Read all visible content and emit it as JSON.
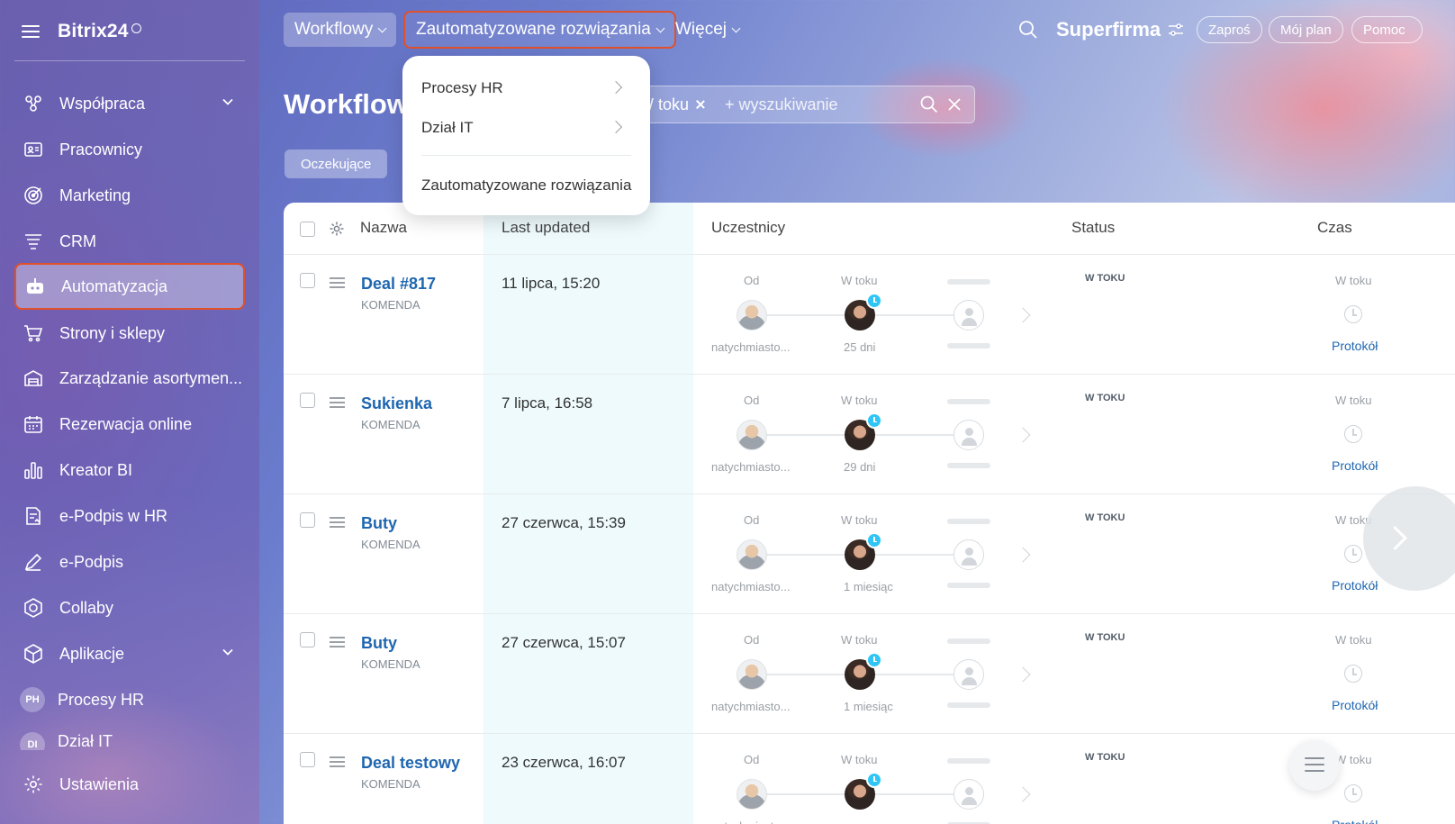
{
  "sidebar": {
    "logo": "Bitrix24",
    "items": [
      {
        "label": "Współpraca",
        "icon": "collaboration-icon",
        "has_chevron": true
      },
      {
        "label": "Pracownicy",
        "icon": "employees-icon"
      },
      {
        "label": "Marketing",
        "icon": "marketing-icon"
      },
      {
        "label": "CRM",
        "icon": "crm-icon"
      },
      {
        "label": "Automatyzacja",
        "icon": "robot-icon",
        "active": true
      },
      {
        "label": "Strony i sklepy",
        "icon": "cart-icon"
      },
      {
        "label": "Zarządzanie asortymen...",
        "icon": "warehouse-icon"
      },
      {
        "label": "Rezerwacja online",
        "icon": "calendar-icon"
      },
      {
        "label": "Kreator BI",
        "icon": "bar-chart-icon"
      },
      {
        "label": "e-Podpis w HR",
        "icon": "document-sign-icon"
      },
      {
        "label": "e-Podpis",
        "icon": "pen-icon"
      },
      {
        "label": "Collaby",
        "icon": "hexagon-icon"
      },
      {
        "label": "Aplikacje",
        "icon": "box-icon",
        "has_chevron": true
      },
      {
        "label": "Procesy HR",
        "badge": "PH"
      },
      {
        "label": "Dział IT",
        "badge": "DI"
      },
      {
        "label": "Ustawienia",
        "icon": "gear-icon"
      }
    ]
  },
  "topbar": {
    "workflowy": "Workflowy",
    "automated": "Zautomatyzowane rozwiązania",
    "more": "Więcej",
    "company": "Superfirma",
    "invite": "Zaproś",
    "plan": "Mój plan",
    "help": "Pomoc"
  },
  "page": {
    "title": "Workflowy",
    "filter_chip": "W toku",
    "search_placeholder": "+ wyszukiwanie",
    "tab_waiting": "Oczekujące"
  },
  "dropdown": {
    "items": [
      "Procesy HR",
      "Dział IT",
      "Zautomatyzowane rozwiązania"
    ]
  },
  "table": {
    "headers": {
      "name": "Nazwa",
      "updated": "Last updated",
      "participants": "Uczestnicy",
      "status": "Status",
      "time": "Czas"
    },
    "labels": {
      "from": "Od",
      "in_progress": "W toku",
      "from_value": "natychmiasto...",
      "status_value": "W TOKU",
      "time_label": "W toku",
      "protocol": "Protokół"
    },
    "rows": [
      {
        "name": "Deal #817",
        "team": "KOMENDA",
        "updated": "11 lipca, 15:20",
        "duration": "25 dni"
      },
      {
        "name": "Sukienka",
        "team": "KOMENDA",
        "updated": "7 lipca, 16:58",
        "duration": "29 dni"
      },
      {
        "name": "Buty",
        "team": "KOMENDA",
        "updated": "27 czerwca, 15:39",
        "duration": "1 miesiąc"
      },
      {
        "name": "Buty",
        "team": "KOMENDA",
        "updated": "27 czerwca, 15:07",
        "duration": "1 miesiąc"
      },
      {
        "name": "Deal testowy",
        "team": "KOMENDA",
        "updated": "23 czerwca, 16:07",
        "duration": ""
      }
    ]
  },
  "colors": {
    "accent_blue": "#2067b0",
    "highlight_red": "#e0502b",
    "badge_cyan": "#2fc6f6"
  }
}
